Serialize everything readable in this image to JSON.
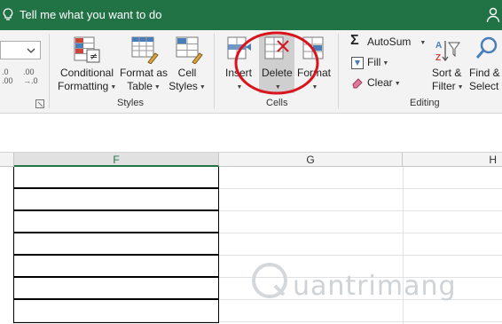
{
  "titlebar": {
    "tell_me": "Tell me what you want to do"
  },
  "ribbon": {
    "number": {
      "decrease_decimal_top": ".0",
      "decrease_decimal_bottom": ".00",
      "increase_decimal_top": ".00",
      "increase_decimal_bottom": "→.0"
    },
    "styles": {
      "conditional_formatting": [
        "Conditional",
        "Formatting"
      ],
      "format_as_table": [
        "Format as",
        "Table"
      ],
      "cell_styles": [
        "Cell",
        "Styles"
      ],
      "group_label": "Styles"
    },
    "cells": {
      "insert": "Insert",
      "delete": "Delete",
      "format": "Format",
      "group_label": "Cells"
    },
    "editing": {
      "autosum": "AutoSum",
      "fill": "Fill",
      "clear": "Clear",
      "sort_filter": [
        "Sort &",
        "Filter"
      ],
      "find_select": [
        "Find &",
        "Select"
      ],
      "group_label": "Editing"
    }
  },
  "grid": {
    "columns": [
      "F",
      "G",
      "H"
    ],
    "selected_column": "F"
  },
  "watermark": {
    "text": "uantrimang"
  },
  "colors": {
    "excel_green": "#217346",
    "annotation_red": "#d9141e"
  }
}
